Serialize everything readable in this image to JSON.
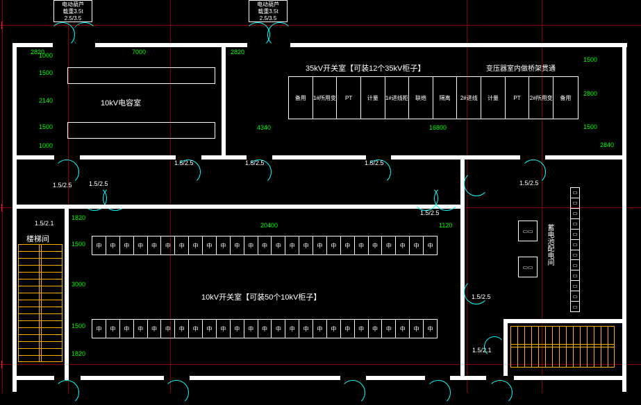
{
  "rooms": {
    "capacitor_room": "10kV电容室",
    "switch35_room": "35kV开关室【可装12个35kV柜子】",
    "switch10_room": "10kV开关室【可装50个10kV柜子】",
    "transformer_note": "变压器室内做桥架贯通",
    "stairwell": "楼梯间",
    "aux_room": "蓄电池配电间"
  },
  "hoists": {
    "label_line1": "电动葫芦",
    "label_line2": "载重3.5t",
    "label_line3": "2.5/3.5"
  },
  "dimensions": {
    "d2820_a": "2820",
    "d7000": "7000",
    "d2820_b": "2820",
    "d1000_a": "1000",
    "d1500_a": "1500",
    "d2140": "2140",
    "d1500_b": "1500",
    "d1000_b": "1000",
    "d4340": "4340",
    "d16800": "16800",
    "d1500_c": "1500",
    "d2800": "2800",
    "d1500_d": "1500",
    "d2840": "2840",
    "d1820_a": "1820",
    "d1500_e": "1500",
    "d3000": "3000",
    "d1500_f": "1500",
    "d1820_b": "1820",
    "d20400": "20400",
    "d1120": "1120"
  },
  "doors": {
    "sz152": "1.5/2.5",
    "sz1521": "1.5/2.1"
  },
  "cabinets_35kv": [
    "备用",
    "1#所用变",
    "PT",
    "计量",
    "1#进线柜",
    "联络",
    "隔离",
    "2#进线",
    "计量",
    "PT",
    "2#所用变",
    "备用"
  ],
  "cabinets_10kv_row_sym": "中",
  "cabinets_right_col_sym": "▭",
  "right_equip": {
    "box_a": "▭▭",
    "box_b": "▭▭"
  }
}
